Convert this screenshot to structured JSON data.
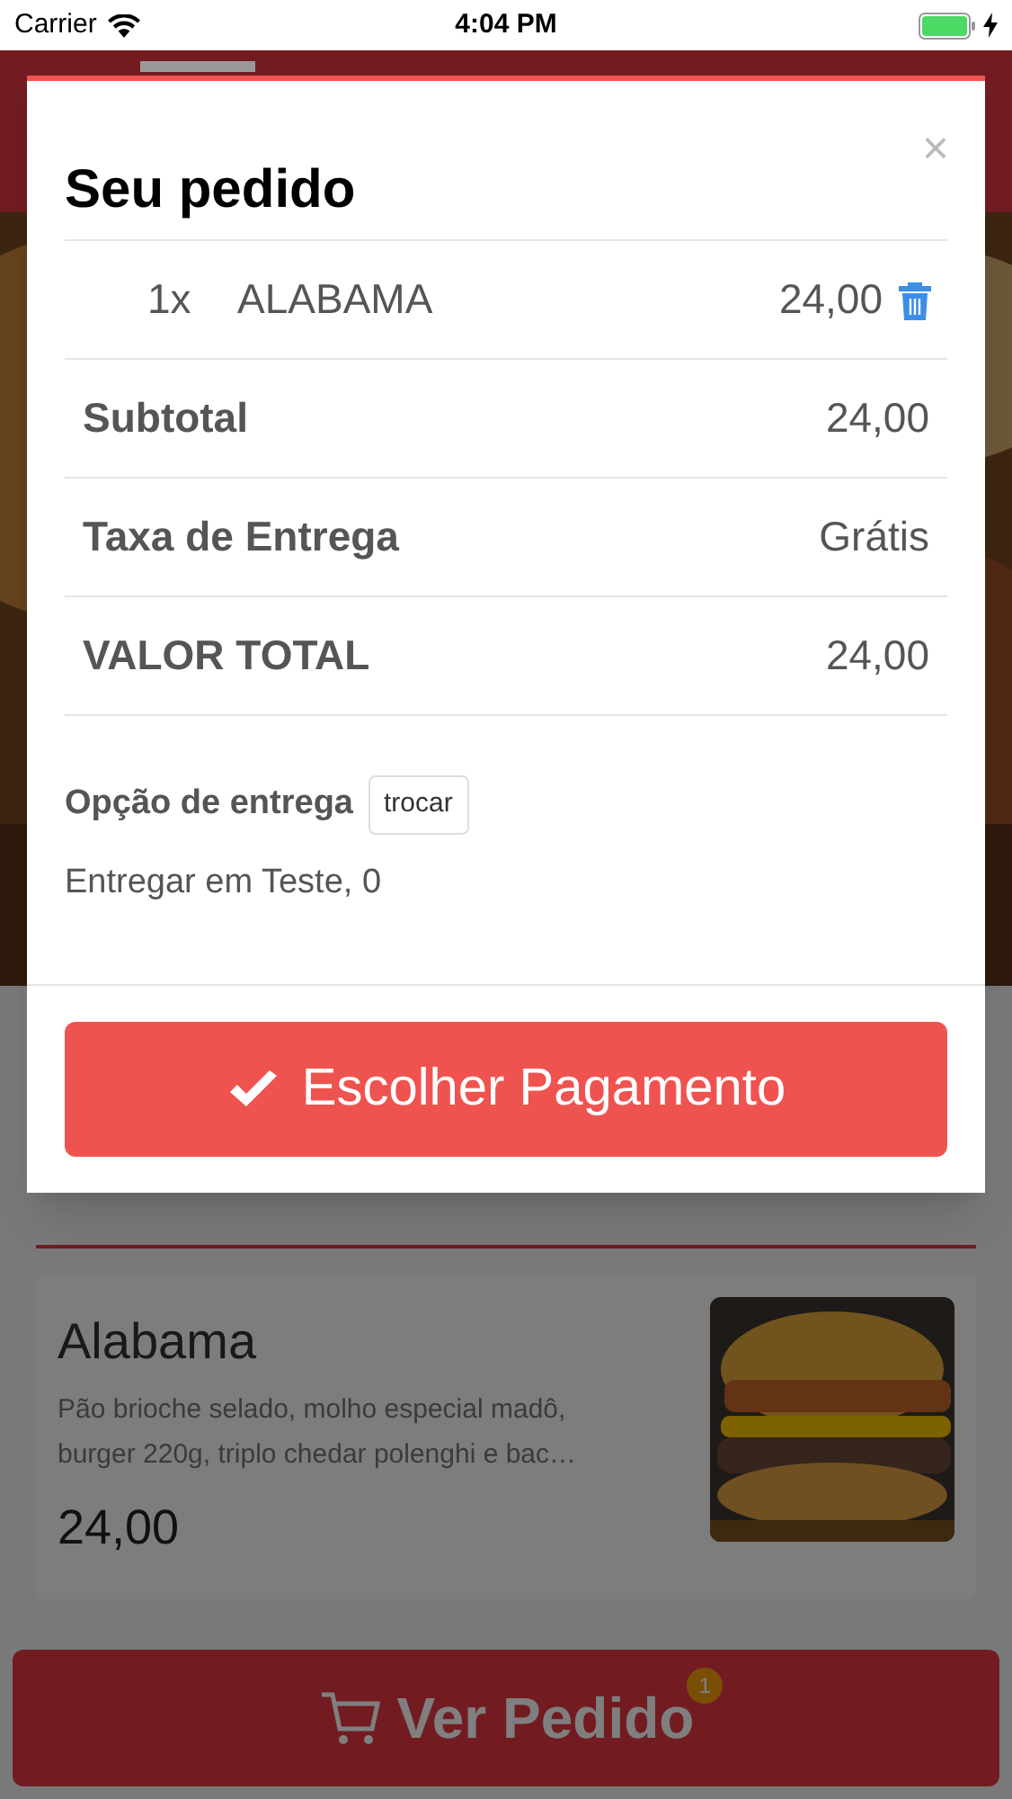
{
  "status_bar": {
    "carrier": "Carrier",
    "time": "4:04 PM"
  },
  "background": {
    "product": {
      "name": "Alabama",
      "description": "Pão brioche selado, molho especial madô, burger 220g, triplo chedar polenghi e bac…",
      "price": "24,00"
    },
    "cart_button": {
      "label": "Ver Pedido",
      "badge": "1"
    }
  },
  "modal": {
    "title": "Seu pedido",
    "close": "×",
    "items": [
      {
        "quantity": "1x",
        "name": "ALABAMA",
        "price": "24,00"
      }
    ],
    "summary": [
      {
        "label": "Subtotal",
        "value": "24,00"
      },
      {
        "label": "Taxa de Entrega",
        "value": "Grátis"
      },
      {
        "label": "VALOR TOTAL",
        "value": "24,00"
      }
    ],
    "delivery": {
      "label": "Opção de entrega",
      "change_button": "trocar",
      "address": "Entregar em Teste, 0"
    },
    "primary_button": "Escolher Pagamento"
  }
}
